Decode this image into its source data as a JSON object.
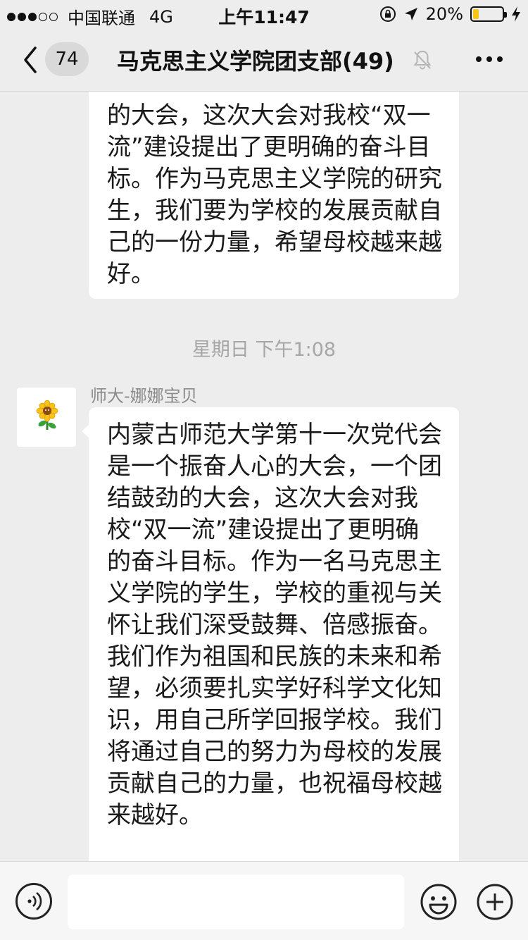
{
  "status_bar": {
    "carrier": "中国联通",
    "network": "4G",
    "time": "上午11:47",
    "battery": "20%",
    "battery_level": 0.2
  },
  "nav": {
    "back_badge": "74",
    "title": "马克思主义学院团支部(49)"
  },
  "messages": [
    {
      "text": "的大会，这次大会对我校“双一流”建设提出了更明确的奋斗目标。作为马克思主义学院的研究生，我们要为学校的发展贡献自己的一份力量，希望母校越来越好。"
    },
    {
      "sender": "师大-娜娜宝贝",
      "text": "内蒙古师范大学第十一次党代会是一个振奋人心的大会，一个团结鼓劲的大会，这次大会对我校“双一流”建设提出了更明确的奋斗目标。作为一名马克思主义学院的学生，学校的重视与关怀让我们深受鼓舞、倍感振奋。我们作为祖国和民族的未来和希望，必须要扎实学好科学文化知识，用自己所学回报学校。我们将通过自己的努力为母校的发展贡献自己的力量，也祝福母校越来越好。"
    }
  ],
  "time_divider": "星期日 下午1:08",
  "input_bar": {
    "placeholder": ""
  },
  "icons": {
    "avatar": "sunflower-icon",
    "voice": "voice-icon",
    "emoji": "smiley-icon",
    "add": "plus-icon",
    "mute": "bell-muted-icon",
    "more": "more-dots-icon",
    "back": "chevron-left-icon"
  }
}
